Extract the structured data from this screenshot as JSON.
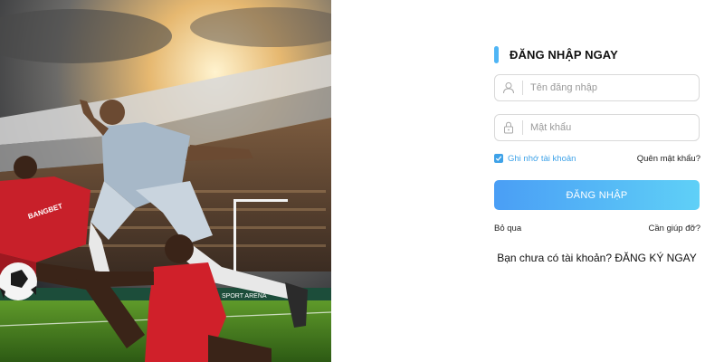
{
  "hero": {
    "image_alt": "Football players in action at a stadium",
    "jersey_text": "BANGBET",
    "ad_board_text": "SPORT ARENA"
  },
  "login": {
    "heading": "ĐĂNG NHẬP NGAY",
    "username_placeholder": "Tên đăng nhập",
    "password_placeholder": "Mật khẩu",
    "remember_label": "Ghi nhớ tài khoản",
    "remember_checked": true,
    "forgot_label": "Quên mật khẩu?",
    "submit_label": "ĐĂNG NHẬP",
    "skip_label": "Bỏ qua",
    "help_label": "Cần giúp đỡ?",
    "register_label": "Bạn chưa có tài khoản? ĐĂNG KÝ NGAY"
  },
  "colors": {
    "accent": "#3ea2e8",
    "button_gradient_start": "#4a9ef5",
    "button_gradient_end": "#5fd0f7",
    "heading_bar": "#4fb5f5"
  },
  "icons": {
    "username": "user-icon",
    "password": "lock-icon",
    "remember": "checkmark-icon"
  }
}
